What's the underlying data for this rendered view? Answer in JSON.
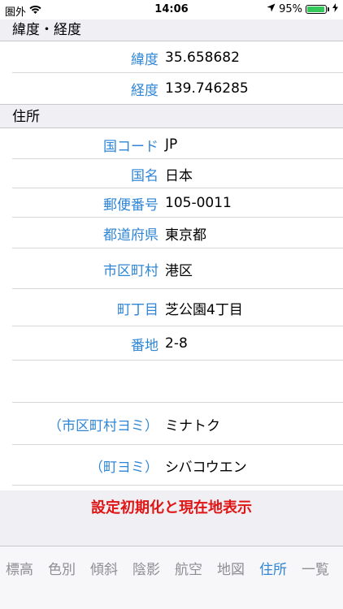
{
  "status": {
    "carrier": "圏外",
    "time": "14:06",
    "battery": "95%",
    "battery_level": 0.95
  },
  "sections": {
    "latlon": {
      "title": "緯度・経度",
      "rows": [
        {
          "label": "緯度",
          "value": "35.658682"
        },
        {
          "label": "経度",
          "value": "139.746285"
        }
      ]
    },
    "address": {
      "title": "住所",
      "rows": [
        {
          "label": "国コード",
          "value": "JP"
        },
        {
          "label": "国名",
          "value": "日本"
        },
        {
          "label": "郵便番号",
          "value": "105-0011"
        },
        {
          "label": "都道府県",
          "value": "東京都"
        },
        {
          "label": "市区町村",
          "value": "港区"
        },
        {
          "label": "町丁目",
          "value": "芝公園4丁目"
        },
        {
          "label": "番地",
          "value": "2-8"
        },
        {
          "label": "",
          "value": ""
        },
        {
          "label": "（市区町村ヨミ）",
          "value": "ミナトク"
        },
        {
          "label": "（町ヨミ）",
          "value": "シバコウエン"
        }
      ]
    }
  },
  "reset_button": "設定初期化と現在地表示",
  "tabs": [
    {
      "label": "標高",
      "active": false
    },
    {
      "label": "色別",
      "active": false
    },
    {
      "label": "傾斜",
      "active": false
    },
    {
      "label": "陰影",
      "active": false
    },
    {
      "label": "航空",
      "active": false
    },
    {
      "label": "地図",
      "active": false
    },
    {
      "label": "住所",
      "active": true
    },
    {
      "label": "一覧",
      "active": false
    }
  ]
}
